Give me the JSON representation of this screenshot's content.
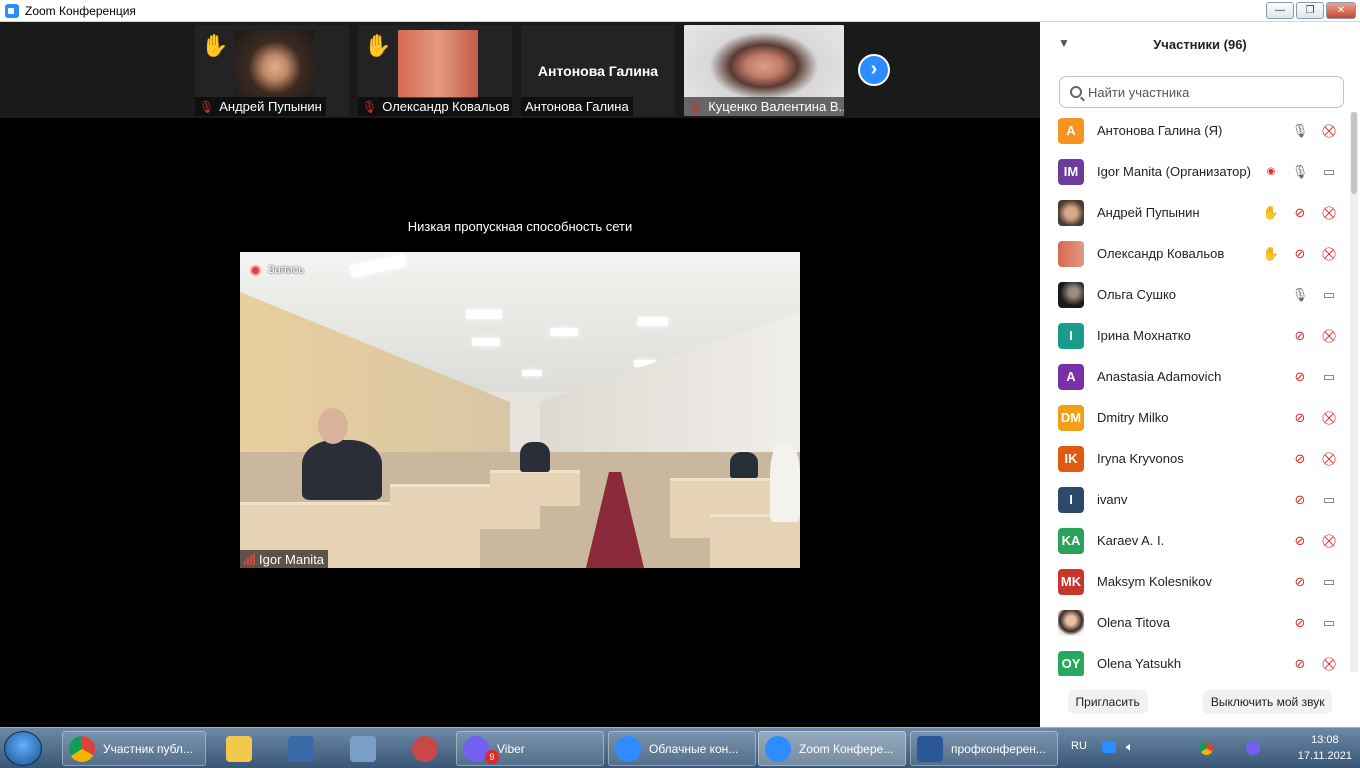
{
  "window": {
    "title": "Zoom Конференция",
    "min": "—",
    "max": "❐",
    "close": "✕"
  },
  "strip": {
    "thumbs": [
      {
        "name": "Андрей Пупынин"
      },
      {
        "name": "Олександр Ковальов"
      },
      {
        "name": "Антонова Галина",
        "big_name": "Антонова Галина"
      },
      {
        "name": "Куценко Валентина В..."
      }
    ],
    "next": "›"
  },
  "main": {
    "network_warning": "Низкая пропускная способность сети",
    "recording_label": "Запись",
    "speaker_name": "Igor Manita"
  },
  "panel": {
    "title": "Участники (96)",
    "search_placeholder": "Найти участника",
    "participants": [
      {
        "initials": "А",
        "name": "Антонова Галина (Я)",
        "color": "#f7931e"
      },
      {
        "initials": "IM",
        "name": "Igor Manita (Организатор)",
        "color": "#6a3c9c"
      },
      {
        "initials": "",
        "name": "Андрей Пупынин",
        "color": "#8a6a50"
      },
      {
        "initials": "",
        "name": "Олександр Ковальов",
        "color": "#b05a48"
      },
      {
        "initials": "",
        "name": "Ольга Сушко",
        "color": "#2b2b2b"
      },
      {
        "initials": "І",
        "name": " Ірина Мохнатко",
        "color": "#1b9c8a"
      },
      {
        "initials": "A",
        "name": "Anastasia Adamovich",
        "color": "#7b2fa8"
      },
      {
        "initials": "DM",
        "name": "Dmitry Milko",
        "color": "#f0a015"
      },
      {
        "initials": "IK",
        "name": "Iryna Kryvonos",
        "color": "#e05a12"
      },
      {
        "initials": "I",
        "name": "ivanv",
        "color": "#2e4a6a"
      },
      {
        "initials": "KA",
        "name": "Karaev A. I.",
        "color": "#2aa35a"
      },
      {
        "initials": "MK",
        "name": "Maksym Kolesnikov",
        "color": "#c8352a"
      },
      {
        "initials": "",
        "name": "Olena Titova",
        "color": "#7a4a3a"
      },
      {
        "initials": "OY",
        "name": "Olena Yatsukh",
        "color": "#27a85c"
      }
    ],
    "invite_label": "Пригласить",
    "mute_all_label": "Выключить мой звук"
  },
  "taskbar": {
    "items": [
      {
        "label": "Участник публ..."
      },
      {
        "label": "Viber",
        "badge": "9"
      },
      {
        "label": "Облачные кон..."
      },
      {
        "label": "Zoom Конфере..."
      },
      {
        "label": "профконферен..."
      }
    ],
    "lang": "RU",
    "time": "13:08",
    "date": "17.11.2021"
  }
}
